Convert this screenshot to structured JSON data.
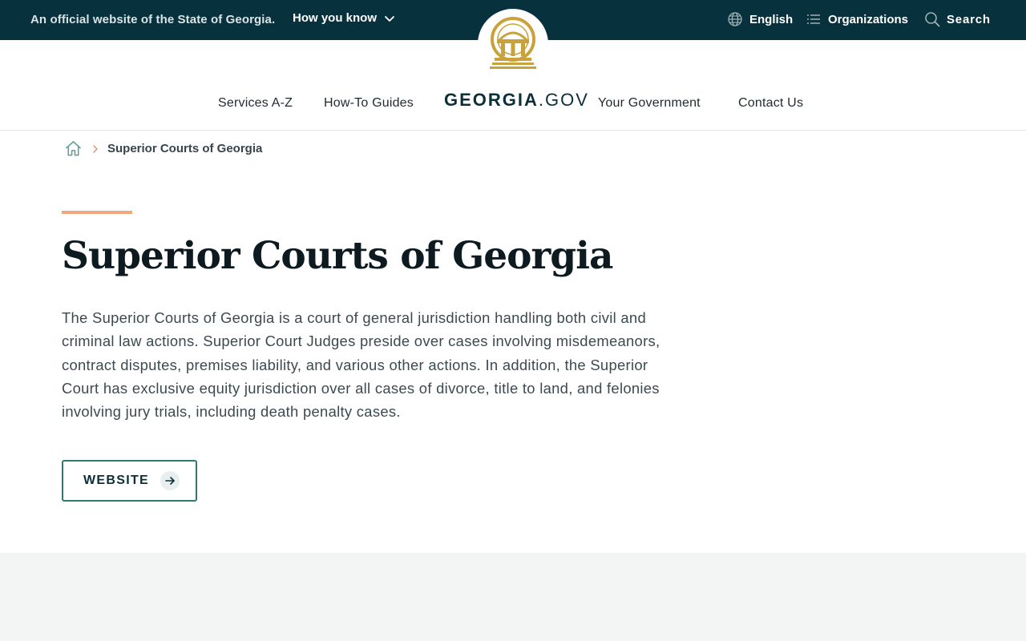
{
  "banner": {
    "official_text": "An official website of the State of Georgia.",
    "how_you_know": "How you know",
    "language": "English",
    "organizations": "Organizations",
    "search": "Search"
  },
  "nav": {
    "services": "Services A-Z",
    "howto": "How-To Guides",
    "brand_bold": "GEORGIA",
    "brand_light": ".GOV",
    "government": "Your Government",
    "contact": "Contact Us"
  },
  "breadcrumb": {
    "current": "Superior Courts of Georgia"
  },
  "main": {
    "title": "Superior Courts of Georgia",
    "description": "The Superior Courts of Georgia is a court of general jurisdiction handling both civil and criminal law actions. Superior Court Judges preside over cases involving misdemeanors, contract disputes, premises liability, and various other actions. In addition, the Superior Court has exclusive equity jurisdiction over all cases of divorce, title to land, and felonies involving jury trials, including death penalty cases.",
    "website_button": "WEBSITE"
  },
  "colors": {
    "banner_bg": "#07323d",
    "accent": "#f0a97e",
    "seal_gold": "#c9a23c",
    "button_border": "#2f7a6f"
  },
  "icons": {
    "how_you_know": "chevron-down-icon",
    "language": "globe-icon",
    "organizations": "list-icon",
    "search": "search-icon",
    "home": "home-icon",
    "breadcrumb_separator": "chevron-right-icon",
    "website": "arrow-right-icon",
    "logo": "georgia-seal-icon"
  }
}
